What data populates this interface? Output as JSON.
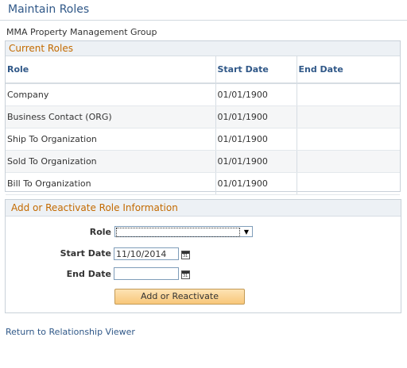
{
  "page": {
    "title": "Maintain Roles",
    "entity_name": "MMA Property Management Group"
  },
  "current_roles": {
    "header": "Current Roles",
    "columns": [
      "Role",
      "Start Date",
      "End Date"
    ],
    "rows": [
      {
        "role": "Company",
        "start": "01/01/1900",
        "end": ""
      },
      {
        "role": "Business Contact (ORG)",
        "start": "01/01/1900",
        "end": ""
      },
      {
        "role": "Ship To Organization",
        "start": "01/01/1900",
        "end": ""
      },
      {
        "role": "Sold To Organization",
        "start": "01/01/1900",
        "end": ""
      },
      {
        "role": "Bill To Organization",
        "start": "01/01/1900",
        "end": ""
      }
    ]
  },
  "add_section": {
    "header": "Add or Reactivate Role Information",
    "role_label": "Role",
    "role_value": "",
    "start_label": "Start Date",
    "start_value": "11/10/2014",
    "end_label": "End Date",
    "end_value": "",
    "button_label": "Add or Reactivate",
    "calendar_glyph": "31"
  },
  "footer": {
    "return_link": "Return to Relationship Viewer"
  },
  "colors": {
    "title": "#305888",
    "section_header": "#c36a00",
    "button": "#f8c77a"
  }
}
